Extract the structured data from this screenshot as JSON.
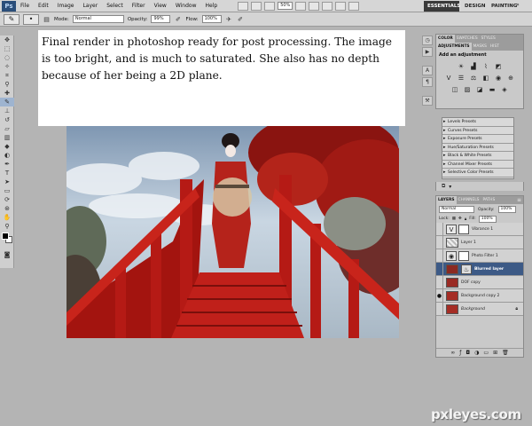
{
  "menubar": {
    "logo": "Ps",
    "items": [
      "File",
      "Edit",
      "Image",
      "Layer",
      "Select",
      "Filter",
      "View",
      "Window",
      "Help"
    ],
    "zoom": "50%",
    "workspaces": {
      "essentials": "ESSENTIALS",
      "design": "DESIGN",
      "painting": "PAINTING",
      "more": "»"
    }
  },
  "options": {
    "mode_label": "Mode:",
    "mode_value": "Normal",
    "opacity_label": "Opacity:",
    "opacity_value": "99%",
    "flow_label": "Flow:",
    "flow_value": "100%"
  },
  "caption": {
    "text": "Final render in photoshop ready for post processing. The image is too bright, and is much to saturated. She also has no depth because of her being a 2D plane."
  },
  "adjustments_panel": {
    "tabs": [
      "COLOR",
      "SWATCHES",
      "STYLES"
    ],
    "tabs2": [
      "ADJUSTMENTS",
      "MASKS",
      "HIST"
    ],
    "title": "Add an adjustment"
  },
  "presets": [
    "Levels Presets",
    "Curves Presets",
    "Exposure Presets",
    "Hue/Saturation Presets",
    "Black & White Presets",
    "Channel Mixer Presets",
    "Selective Color Presets"
  ],
  "layers_panel": {
    "tabs": [
      "LAYERS",
      "CHANNELS",
      "PATHS"
    ],
    "blend_mode": "Normal",
    "opacity_label": "Opacity:",
    "opacity_value": "100%",
    "lock_label": "Lock:",
    "fill_label": "Fill:",
    "fill_value": "100%",
    "layers": [
      {
        "name": "Vibrance 1",
        "visible": false,
        "selected": false
      },
      {
        "name": "Layer 1",
        "visible": false,
        "selected": false
      },
      {
        "name": "Photo Filter 1",
        "visible": false,
        "selected": false
      },
      {
        "name": "Blurred layer",
        "visible": false,
        "selected": true
      },
      {
        "name": "DOF copy",
        "visible": false,
        "selected": false
      },
      {
        "name": "Background copy 2",
        "visible": true,
        "selected": false
      },
      {
        "name": "Background",
        "visible": false,
        "selected": false
      }
    ]
  },
  "watermark": "pxleyes.com"
}
